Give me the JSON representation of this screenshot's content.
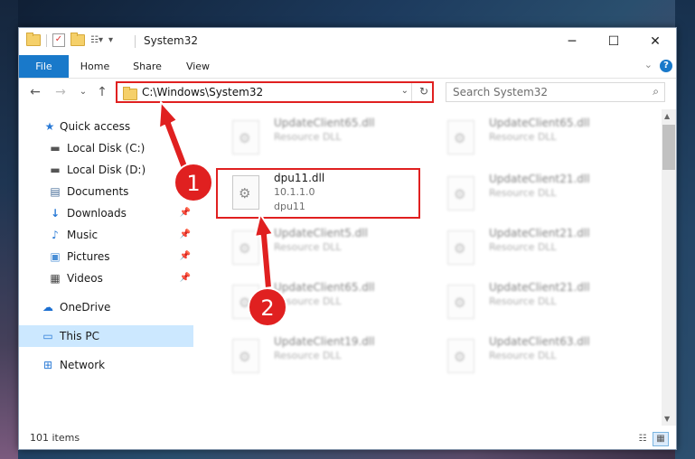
{
  "window": {
    "title": "System32",
    "minimize": "─",
    "maximize": "☐",
    "close": "✕"
  },
  "ribbon": {
    "tabs": [
      "File",
      "Home",
      "Share",
      "View"
    ],
    "expand": "⌄",
    "help": "?"
  },
  "nav": {
    "back": "←",
    "forward": "→",
    "recent": "⌄",
    "up": "↑",
    "address": "C:\\Windows\\System32",
    "search_placeholder": "Search System32"
  },
  "sidebar": {
    "items": [
      {
        "label": "Quick access",
        "icon": "★"
      },
      {
        "label": "Local Disk (C:)",
        "icon": "▬"
      },
      {
        "label": "Local Disk (D:)",
        "icon": "▬"
      },
      {
        "label": "Documents",
        "icon": "▤"
      },
      {
        "label": "Downloads",
        "icon": "↓"
      },
      {
        "label": "Music",
        "icon": "♪"
      },
      {
        "label": "Pictures",
        "icon": "▣"
      },
      {
        "label": "Videos",
        "icon": "▦"
      },
      {
        "label": "OneDrive",
        "icon": "☁"
      },
      {
        "label": "This PC",
        "icon": "▭"
      },
      {
        "label": "Network",
        "icon": "⊞"
      }
    ],
    "pin": "📌"
  },
  "files": {
    "highlighted": {
      "name": "dpu11.dll",
      "version": "10.1.1.0",
      "desc": "dpu11"
    },
    "left_column": [
      {
        "name": "UpdateClient65.dll",
        "type": "Resource DLL"
      },
      {
        "name": "UpdateClient5.dll",
        "type": "Resource DLL"
      },
      {
        "name": "UpdateClient65.dll",
        "type": "Resource DLL"
      },
      {
        "name": "UpdateClient19.dll",
        "type": "Resource DLL"
      }
    ],
    "right_column": [
      {
        "name": "UpdateClient65.dll",
        "type": "Resource DLL"
      },
      {
        "name": "UpdateClient21.dll",
        "type": "Resource DLL"
      },
      {
        "name": "UpdateClient21.dll",
        "type": "Resource DLL"
      },
      {
        "name": "UpdateClient21.dll",
        "type": "Resource DLL"
      },
      {
        "name": "UpdateClient63.dll",
        "type": "Resource DLL"
      }
    ]
  },
  "status": {
    "items": "101 items"
  },
  "annotations": {
    "step1": "1",
    "step2": "2",
    "color": "#e02020"
  }
}
